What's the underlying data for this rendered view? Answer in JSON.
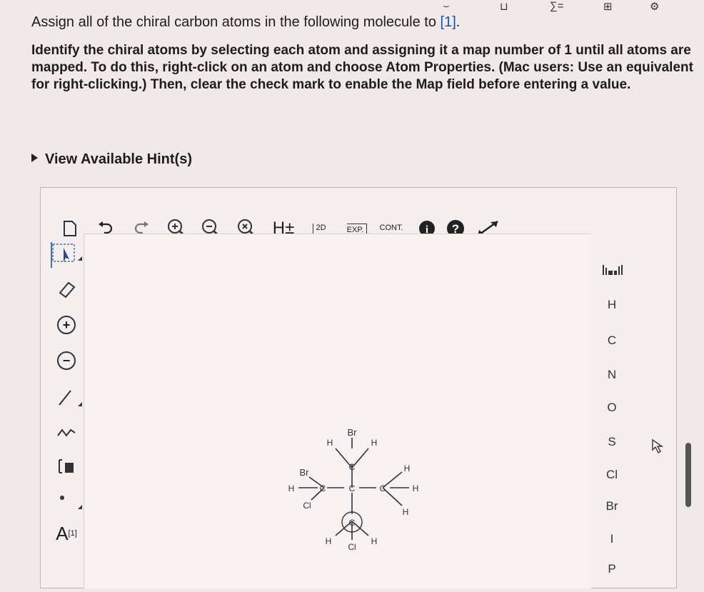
{
  "question": {
    "title_prefix": "Assign all of the chiral carbon atoms in the following molecule to ",
    "title_link": "[1]",
    "title_suffix": ".",
    "body": "Identify the chiral atoms by selecting each atom and assigning it a map number of 1 until all atoms are mapped. To do this, right-click on an atom and choose Atom Properties. (Mac users: Use an equivalent for right-clicking.) Then, clear the check mark to enable the Map field before entering a value."
  },
  "hint_label": "View Available Hint(s)",
  "toolbar": {
    "h_toggle": "H±",
    "twod": "2D",
    "exp": "EXP.",
    "cont": "CONT."
  },
  "left_tools": {
    "atom_map_label": "A",
    "atom_map_sup": "[1]"
  },
  "periodic": {
    "elements": [
      "H",
      "C",
      "N",
      "O",
      "S",
      "Cl",
      "Br",
      "I",
      "P"
    ]
  },
  "molecule": {
    "atoms": {
      "br_top": "Br",
      "h_top_left": "H",
      "h_top_right": "H",
      "c_top": "C",
      "br_left": "Br",
      "h_left": "H",
      "c_left": "C",
      "c_center": "C",
      "c_right": "C",
      "h_right_top": "H",
      "h_right": "H",
      "h_right_bottom": "H",
      "cl_left": "Cl",
      "c_bottom": "C",
      "h_bottom_left": "H",
      "h_bottom_right": "H",
      "cl_bottom": "Cl"
    }
  }
}
